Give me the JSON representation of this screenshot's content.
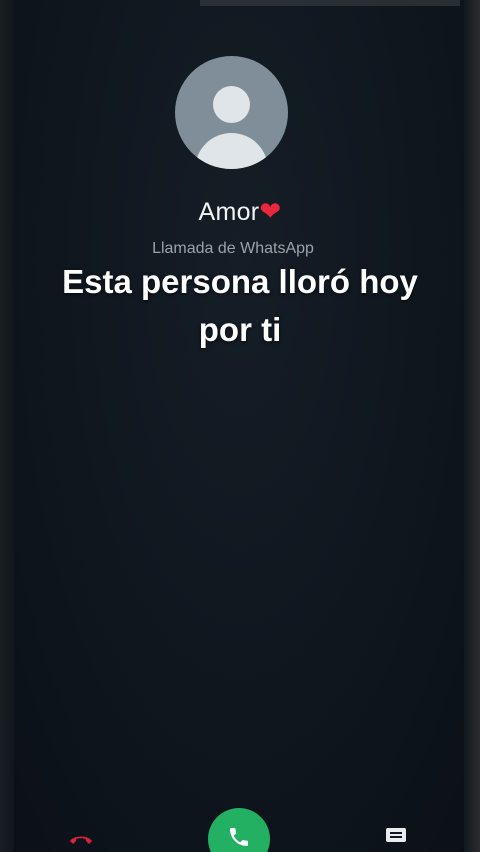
{
  "caller": {
    "name": "Amor",
    "emoji": "❤",
    "call_type": "Llamada de WhatsApp"
  },
  "overlay": {
    "line1": "Esta persona lloró hoy",
    "line2": "por ti"
  },
  "icons": {
    "avatar": "default-contact-avatar",
    "decline": "phone-hangup-icon",
    "answer": "phone-icon",
    "message": "message-icon"
  },
  "colors": {
    "background": "#0f161e",
    "answer_green": "#23b063",
    "decline_red": "#e8283c",
    "avatar_gray": "#7f8e98"
  }
}
